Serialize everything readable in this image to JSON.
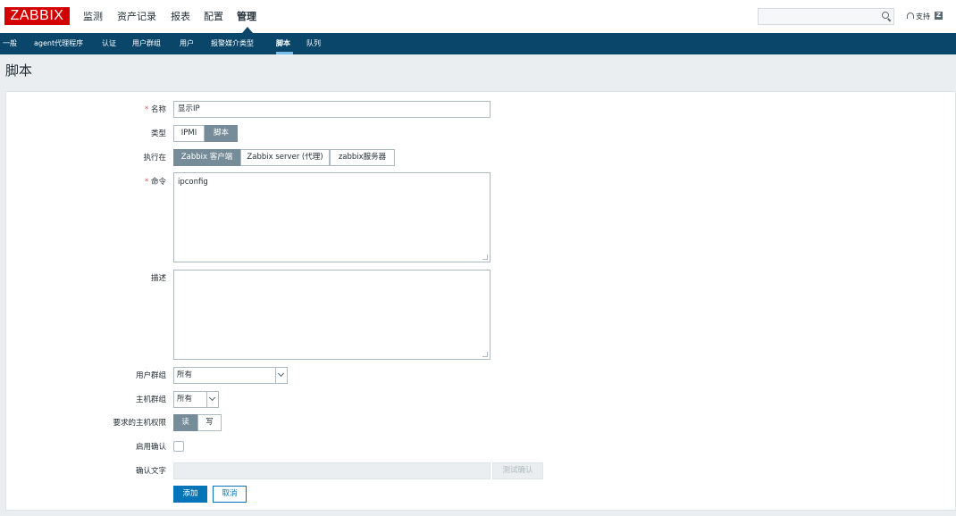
{
  "header": {
    "logo": "ZABBIX",
    "nav": [
      "监测",
      "资产记录",
      "报表",
      "配置",
      "管理"
    ],
    "active_nav": "管理",
    "support": "支持",
    "share": "Z"
  },
  "subnav": {
    "items": [
      "一般",
      "agent代理程序",
      "认证",
      "用户群组",
      "用户",
      "报警媒介类型",
      "脚本",
      "队列"
    ],
    "active": "脚本"
  },
  "page": {
    "title": "脚本"
  },
  "form": {
    "name": {
      "required_mark": "*",
      "label": "名称",
      "value": "显示IP"
    },
    "type": {
      "label": "类型",
      "options": [
        "IPMI",
        "脚本"
      ],
      "selected": "脚本"
    },
    "execute_on": {
      "label": "执行在",
      "options": [
        "Zabbix 客户端",
        "Zabbix server (代理)",
        "zabbix服务器"
      ],
      "selected": "Zabbix 客户端"
    },
    "command": {
      "required_mark": "*",
      "label": "命令",
      "value": "ipconfig"
    },
    "description": {
      "label": "描述",
      "value": ""
    },
    "user_group": {
      "label": "用户群组",
      "value": "所有"
    },
    "host_group": {
      "label": "主机群组",
      "value": "所有"
    },
    "host_access": {
      "label": "要求的主机权限",
      "options": [
        "读",
        "写"
      ],
      "selected": "读"
    },
    "enable_confirm": {
      "label": "启用确认",
      "checked": false
    },
    "confirm_text": {
      "label": "确认文字",
      "value": "",
      "test_button": "测试确认"
    },
    "add_button": "添加",
    "cancel_button": "取消"
  },
  "colors": {
    "logo_red": "#d40000",
    "subnav_blue": "#0a466a",
    "button_blue": "#0275b8",
    "segment_active": "#768d99",
    "required_red": "#e45959"
  }
}
